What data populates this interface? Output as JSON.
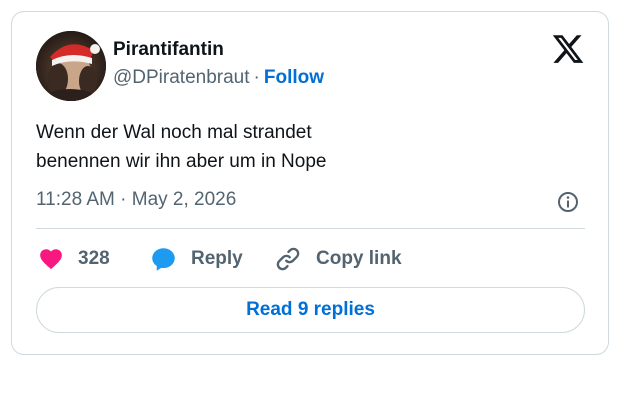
{
  "author": {
    "display_name": "Pirantifantin",
    "handle": "@DPiratenbraut",
    "separator": "·",
    "follow_label": "Follow"
  },
  "tweet": {
    "lines": [
      "Wenn der Wal noch mal strandet",
      "benennen wir ihn aber um in Nope"
    ],
    "timestamp": "11:28 AM · May 2, 2026"
  },
  "actions": {
    "like_count": "328",
    "reply_label": "Reply",
    "copy_label": "Copy link"
  },
  "read_replies_label": "Read 9 replies",
  "icons": {
    "brand": "x-logo-icon",
    "info": "info-icon",
    "like": "heart-icon",
    "reply": "speech-bubble-icon",
    "copy": "link-icon"
  },
  "colors": {
    "like": "#f91880",
    "reply": "#1d9bf0",
    "link": "#006fd6",
    "secondary_text": "#536471",
    "border": "#cfd9de"
  }
}
